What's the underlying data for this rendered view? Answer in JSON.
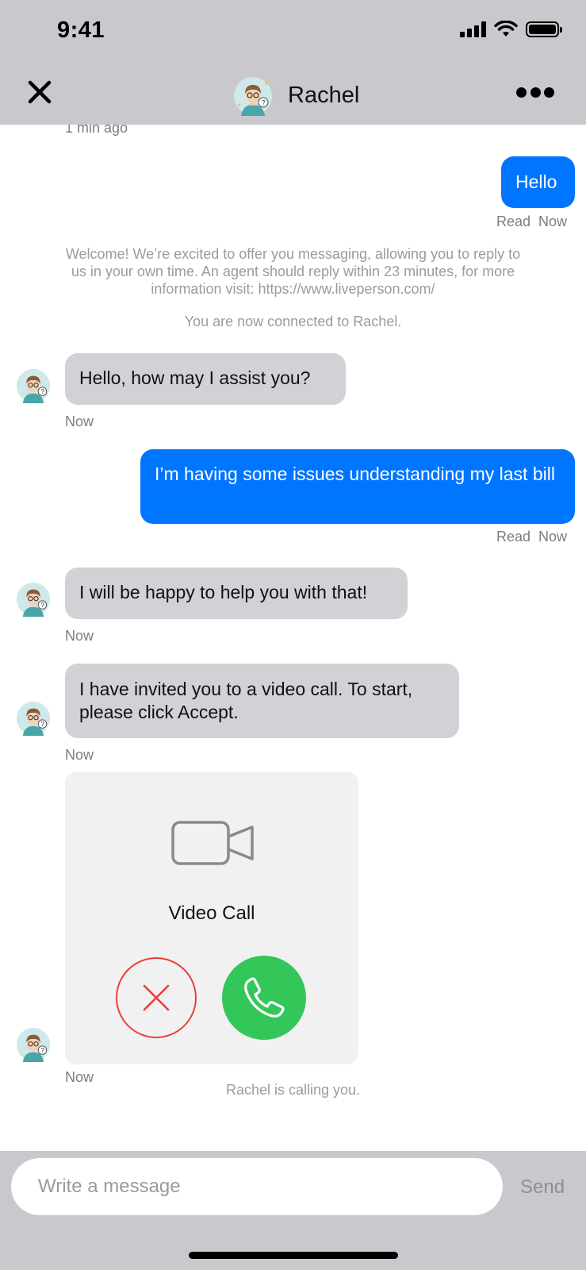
{
  "status_bar": {
    "time": "9:41"
  },
  "header": {
    "title": "Rachel"
  },
  "messages": {
    "top_timestamp": "1 min ago",
    "m1": {
      "text": "Hello",
      "read": "Read",
      "time": "Now"
    },
    "welcome": "Welcome! We’re excited to offer you messaging, allowing you to reply to us in your own time. An agent should reply within 23 minutes, for more information visit: https://www.liveperson.com/",
    "connected": "You are now connected to Rachel.",
    "m2": {
      "text": "Hello, how may I assist you?",
      "time": "Now"
    },
    "m3": {
      "text": "I’m having some issues understanding my last bill",
      "read": "Read",
      "time": "Now"
    },
    "m4": {
      "text": "I will be happy to help you with that!",
      "time": "Now"
    },
    "m5": {
      "text": "I have invited you to a video call. To start, please click Accept.",
      "time": "Now"
    },
    "video_call": {
      "label": "Video Call",
      "time": "Now"
    },
    "calling": "Rachel is calling you."
  },
  "composer": {
    "placeholder": "Write a message",
    "send_label": "Send"
  },
  "colors": {
    "outgoing": "#0075ff",
    "incoming": "#d2d2d6",
    "accept": "#33c759",
    "decline": "#e8403a",
    "bar": "#c8c8cd"
  }
}
